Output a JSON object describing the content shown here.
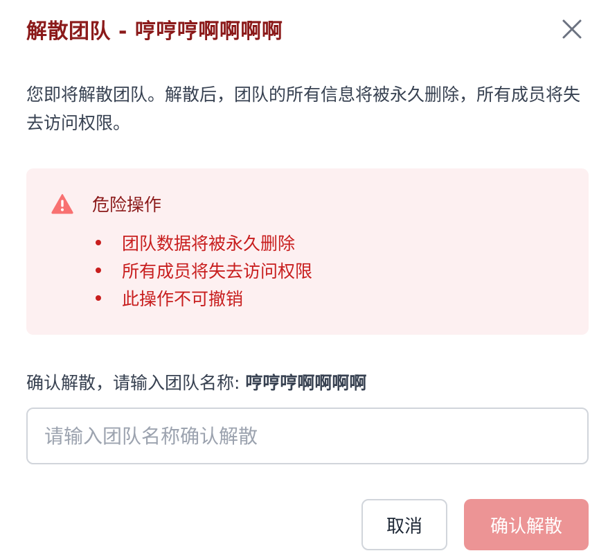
{
  "dialog": {
    "title": "解散团队 - 哼哼哼啊啊啊啊",
    "description": "您即将解散团队。解散后，团队的所有信息将被永久删除，所有成员将失去访问权限。"
  },
  "warning": {
    "title": "危险操作",
    "items": [
      "团队数据将被永久删除",
      "所有成员将失去访问权限",
      "此操作不可撤销"
    ]
  },
  "confirm": {
    "label_prefix": "确认解散，请输入团队名称: ",
    "team_name": "哼哼哼啊啊啊啊",
    "value": "",
    "placeholder": "请输入团队名称确认解散"
  },
  "buttons": {
    "cancel_label": "取消",
    "dissolve_label": "确认解散",
    "dissolve_disabled": true
  },
  "icons": {
    "close": "close-icon",
    "warning": "warning-triangle-icon"
  },
  "colors": {
    "title": "#8b1a1a",
    "danger_text": "#c81e1e",
    "warning_bg": "#fdf0f1",
    "warning_icon": "#f87171",
    "dissolve_button_disabled": "#ec9495"
  }
}
